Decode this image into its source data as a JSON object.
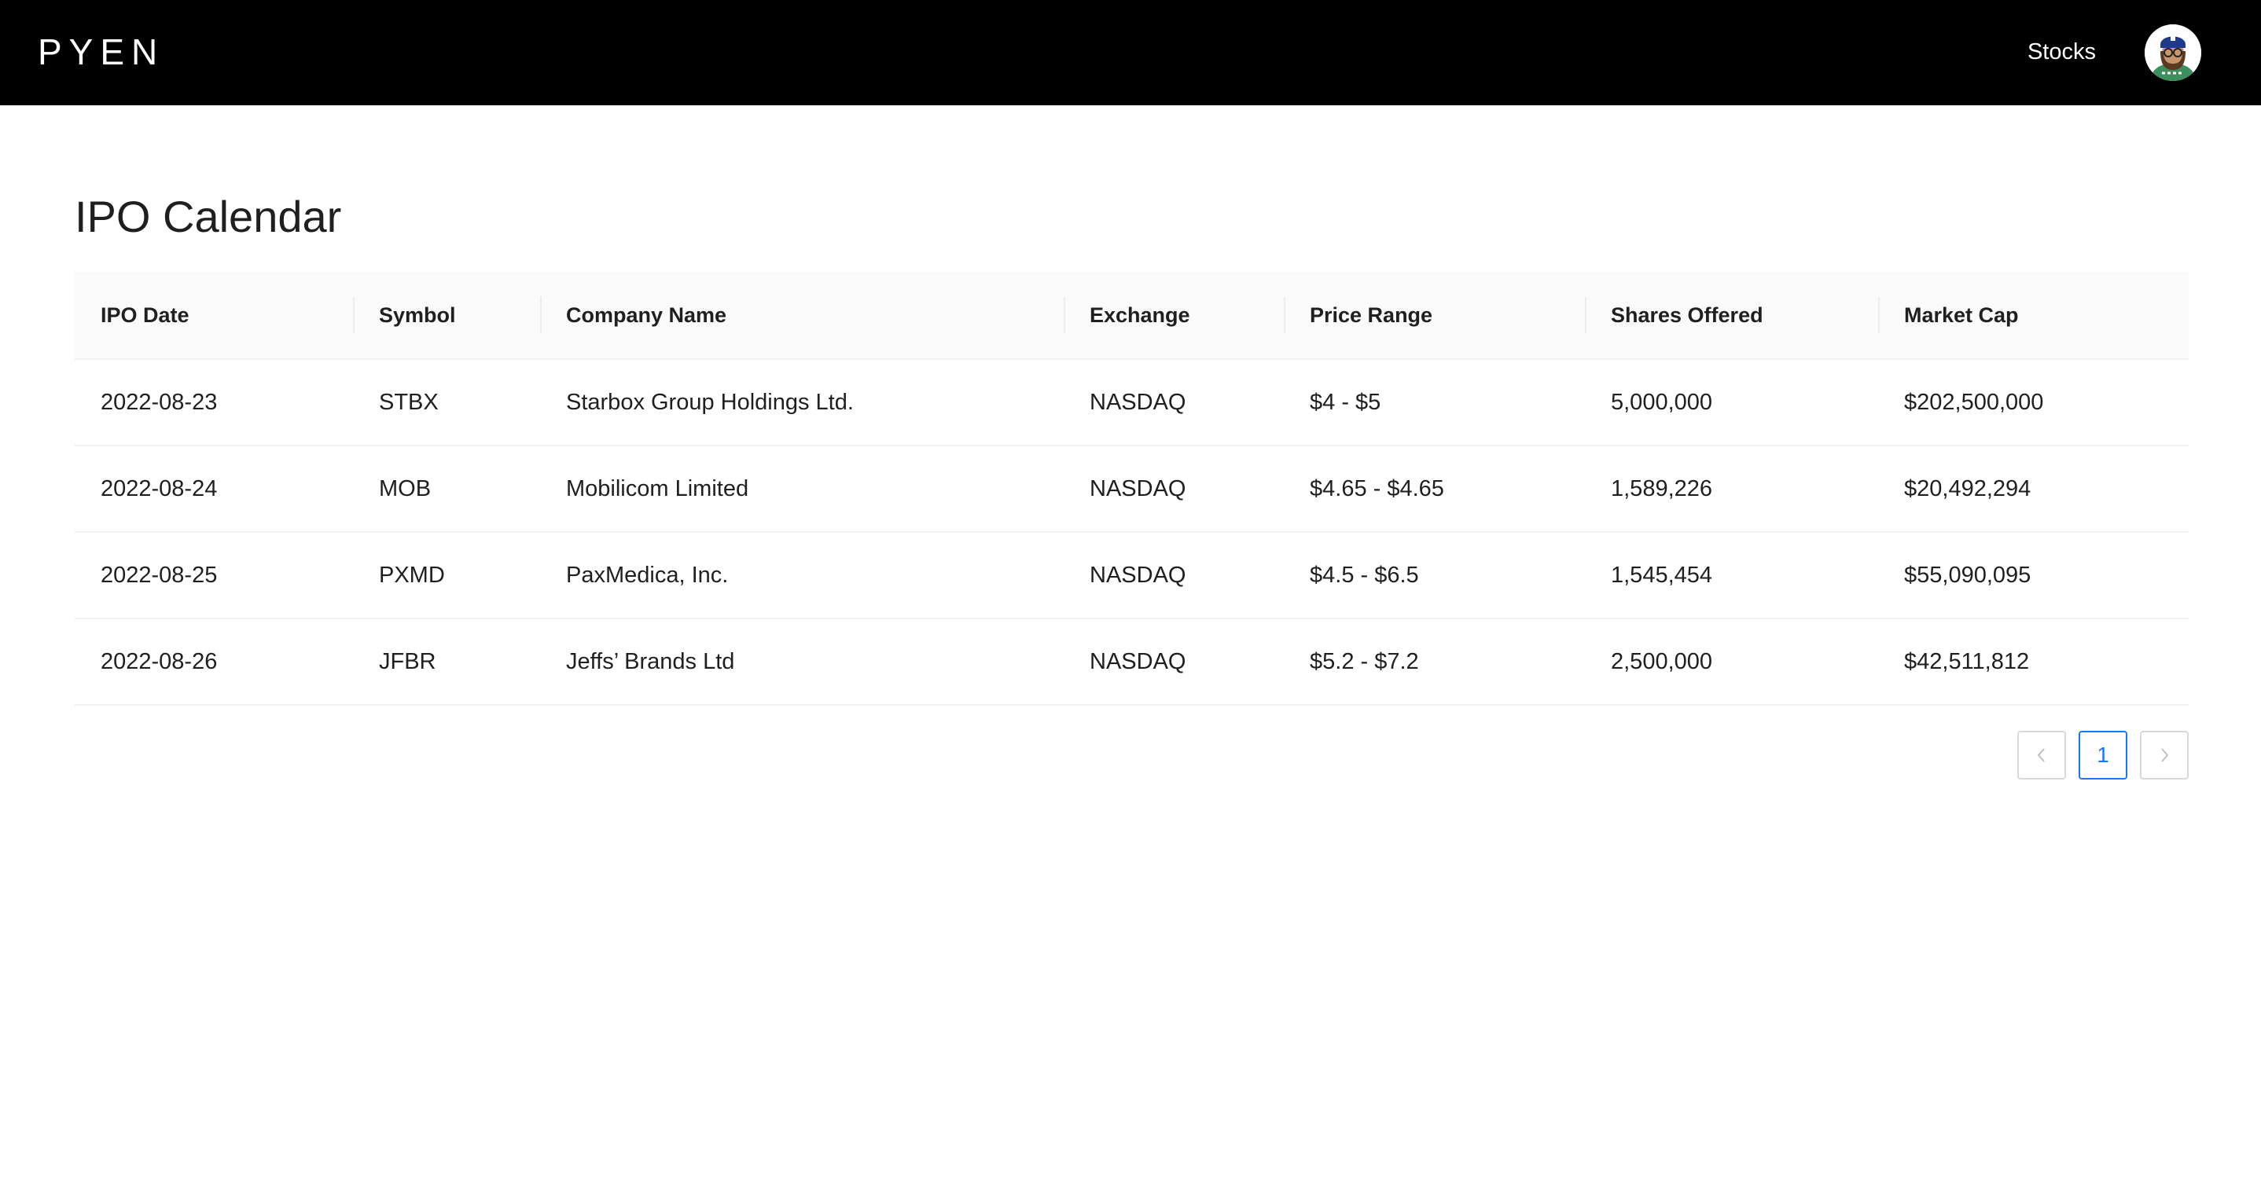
{
  "header": {
    "logo": "PYEN",
    "nav_stocks": "Stocks",
    "avatar_icon": "user-avatar-icon"
  },
  "page": {
    "title": "IPO Calendar"
  },
  "table": {
    "columns": [
      "IPO Date",
      "Symbol",
      "Company Name",
      "Exchange",
      "Price Range",
      "Shares Offered",
      "Market Cap"
    ],
    "rows": [
      [
        "2022-08-23",
        "STBX",
        "Starbox Group Holdings Ltd.",
        "NASDAQ",
        "$4 - $5",
        "5,000,000",
        "$202,500,000"
      ],
      [
        "2022-08-24",
        "MOB",
        "Mobilicom Limited",
        "NASDAQ",
        "$4.65 - $4.65",
        "1,589,226",
        "$20,492,294"
      ],
      [
        "2022-08-25",
        "PXMD",
        "PaxMedica, Inc.",
        "NASDAQ",
        "$4.5 - $6.5",
        "1,545,454",
        "$55,090,095"
      ],
      [
        "2022-08-26",
        "JFBR",
        "Jeffs’ Brands Ltd",
        "NASDAQ",
        "$5.2 - $7.2",
        "2,500,000",
        "$42,511,812"
      ]
    ]
  },
  "pagination": {
    "prev_icon": "chevron-left-icon",
    "current_page": "1",
    "next_icon": "chevron-right-icon",
    "accent_color": "#1677ff"
  },
  "colors": {
    "topbar_bg": "#000000",
    "header_row_bg": "#fafafa",
    "row_border": "#f0f0f0"
  }
}
